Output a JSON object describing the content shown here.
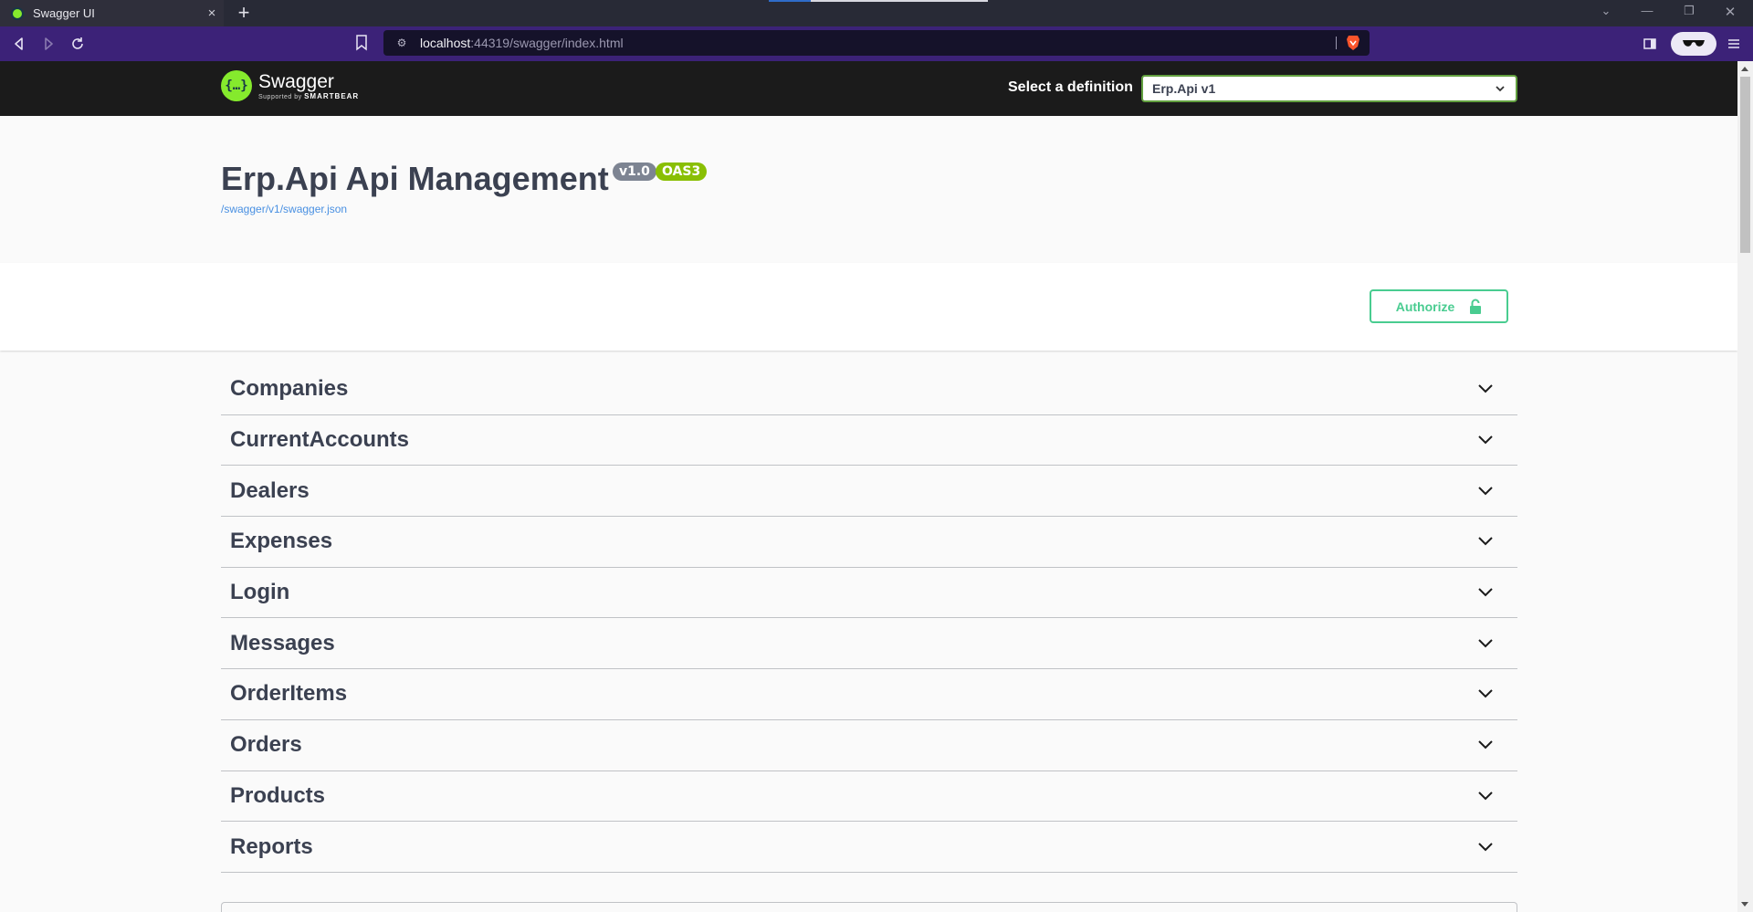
{
  "browser": {
    "tab_title": "Swagger UI",
    "tab_close": "×",
    "new_tab": "+",
    "url_host": "localhost",
    "url_rest": ":44319/swagger/index.html"
  },
  "topbar": {
    "logo_name": "Swagger",
    "logo_sub_prefix": "Supported by ",
    "logo_sub_brand": "SMARTBEAR",
    "definition_label": "Select a definition",
    "definition_value": "Erp.Api v1"
  },
  "info": {
    "title": "Erp.Api Api Management",
    "version_badge": "v1.0",
    "oas_badge": "OAS3",
    "spec_link": "/swagger/v1/swagger.json"
  },
  "scheme": {
    "authorize_label": "Authorize"
  },
  "tags": [
    {
      "name": "Companies"
    },
    {
      "name": "CurrentAccounts"
    },
    {
      "name": "Dealers"
    },
    {
      "name": "Expenses"
    },
    {
      "name": "Login"
    },
    {
      "name": "Messages"
    },
    {
      "name": "OrderItems"
    },
    {
      "name": "Orders"
    },
    {
      "name": "Products"
    },
    {
      "name": "Reports"
    }
  ],
  "colors": {
    "swagger_green": "#85ea2d",
    "authorize_green": "#49cc90",
    "browser_toolbar": "#3c2278",
    "text_dark": "#3b4151"
  }
}
